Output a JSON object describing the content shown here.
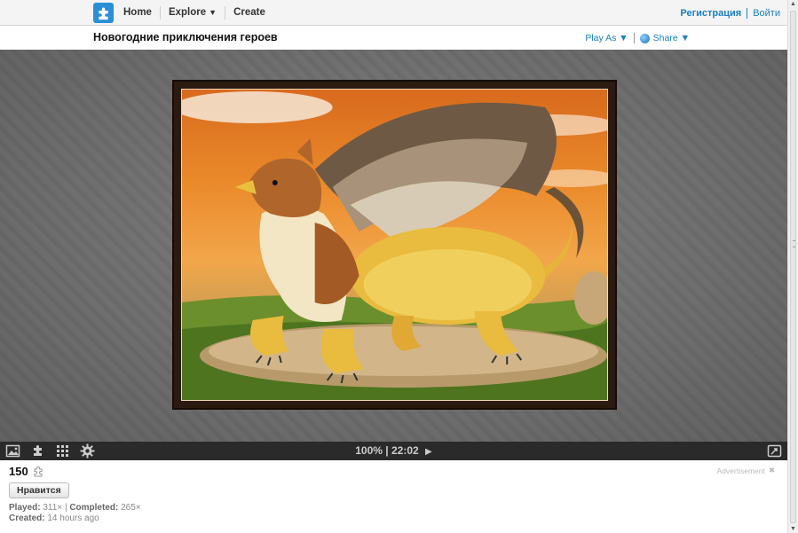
{
  "nav": {
    "home": "Home",
    "explore": "Explore",
    "explore_caret": "▼",
    "create": "Create"
  },
  "auth": {
    "register": "Регистрация",
    "login": "Войти"
  },
  "puzzle": {
    "title": "Новогодние приключения героев",
    "play_as": "Play As ▼",
    "share": "Share ▼"
  },
  "toolbar": {
    "progress": "100%",
    "separator": "|",
    "timer": "22:02",
    "play_glyph": "▶"
  },
  "info": {
    "pieces": "150",
    "like_button": "Нравится",
    "played_label": "Played:",
    "played_value": "311×",
    "completed_label": "Completed:",
    "completed_value": "265×",
    "created_label": "Created:",
    "created_value": "14 hours ago",
    "advertisement": "Advertisement",
    "ad_close": "✖"
  },
  "icons": {
    "logo": "puzzle-piece-icon",
    "tools": [
      "image-icon",
      "piece-shape-icon",
      "grid-icon",
      "gear-icon",
      "fullscreen-icon"
    ]
  },
  "colors": {
    "accent": "#1a7fc3",
    "logo_bg": "#2a8fd6",
    "toolbar_bg": "#2a2a2a",
    "stage_bg": "#7a7a7a"
  }
}
